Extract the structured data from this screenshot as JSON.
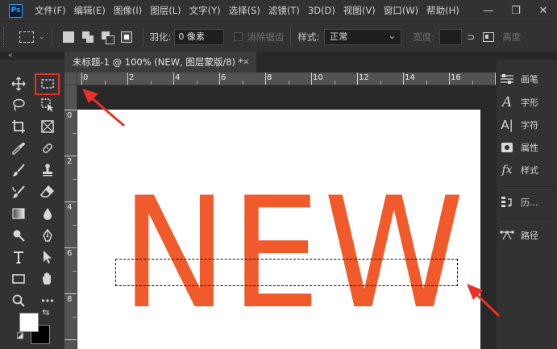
{
  "app": {
    "logo_text": "Ps"
  },
  "menu": {
    "items": [
      "文件(F)",
      "编辑(E)",
      "图像(I)",
      "图层(L)",
      "文字(Y)",
      "选择(S)",
      "滤镜(T)",
      "3D(D)",
      "视图(V)",
      "窗口(W)",
      "帮助(H)"
    ]
  },
  "window_controls": {
    "minimize": "—",
    "restore": "❐",
    "close": "✕"
  },
  "options_bar": {
    "feather_label": "羽化:",
    "feather_value": "0 像素",
    "antialias_label": "消除锯齿",
    "style_label": "样式:",
    "style_value": "正常",
    "width_label": "宽度:",
    "height_label": "高度"
  },
  "document": {
    "tab_title": "未标题-1 @ 100% (NEW, 图层蒙版/8) *",
    "close_glyph": "×",
    "canvas_text": "NEW",
    "text_color": "#f15a2b"
  },
  "rulers": {
    "top_labels": [
      "0",
      "2",
      "4",
      "6",
      "8",
      "10",
      "12",
      "14",
      "16"
    ],
    "left_labels": [
      "0",
      "2",
      "4",
      "6",
      "8"
    ]
  },
  "right_panel": {
    "items": [
      {
        "icon": "brush-settings-icon",
        "label": "画笔"
      },
      {
        "icon": "character-icon",
        "label": "字形"
      },
      {
        "icon": "paragraph-icon",
        "label": "字符"
      },
      {
        "icon": "properties-icon",
        "label": "属性"
      },
      {
        "icon": "fx-icon",
        "label": "样式"
      },
      {
        "icon": "history-icon",
        "label": "历..."
      },
      {
        "icon": "paths-icon",
        "label": "路径"
      }
    ]
  },
  "colors": {
    "annotation": "#e8312a",
    "foreground": "#ffffff",
    "background": "#000000"
  }
}
